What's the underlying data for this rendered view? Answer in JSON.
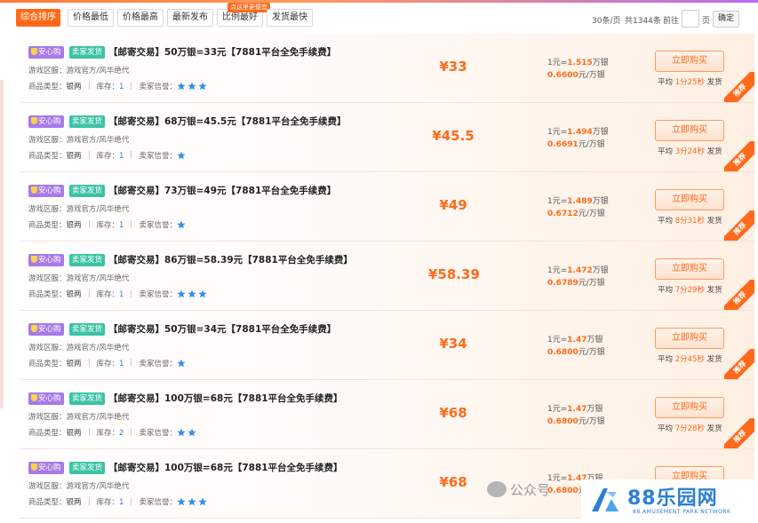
{
  "sort": {
    "tabs": [
      {
        "label": "综合排序",
        "active": true
      },
      {
        "label": "价格最低",
        "active": false
      },
      {
        "label": "价格最高",
        "active": false
      },
      {
        "label": "最新发布",
        "active": false
      },
      {
        "label": "比例最好",
        "active": false
      },
      {
        "label": "发货最快",
        "active": false
      }
    ],
    "promo_tag": "点这里更便宜"
  },
  "pager": {
    "per_page": "30条/页",
    "total": "共1344条",
    "goto_label": "前往",
    "page_input_value": "",
    "page_unit": "页",
    "confirm_label": "确定"
  },
  "labels": {
    "safe_badge": "安心购",
    "seller_badge": "卖家发货",
    "server_label": "游戏区服：",
    "type_label": "商品类型：",
    "stock_label": "库存：",
    "credit_label": "卖家信誉：",
    "buy_label": "立即购买",
    "avg_prefix": "平均",
    "avg_suffix": "发货",
    "ribbon": "推荐",
    "rate_prefix": "1元=",
    "rate_suffix": "万银",
    "unit_suffix": "元/万银"
  },
  "listings": [
    {
      "title": "【邮寄交易】50万银=33元【7881平台全免手续费】",
      "server": "游戏官方/风华绝代",
      "type": "银两",
      "stock": "1",
      "stars": 3,
      "price": "¥33",
      "rate": "1.515",
      "unit_price": "0.6600",
      "avg_time": "1分25秒"
    },
    {
      "title": "【邮寄交易】68万银=45.5元【7881平台全免手续费】",
      "server": "游戏官方/风华绝代",
      "type": "银两",
      "stock": "1",
      "stars": 1,
      "price": "¥45.5",
      "rate": "1.494",
      "unit_price": "0.6691",
      "avg_time": "3分24秒"
    },
    {
      "title": "【邮寄交易】73万银=49元【7881平台全免手续费】",
      "server": "游戏官方/风华绝代",
      "type": "银两",
      "stock": "1",
      "stars": 1,
      "price": "¥49",
      "rate": "1.489",
      "unit_price": "0.6712",
      "avg_time": "8分31秒"
    },
    {
      "title": "【邮寄交易】86万银=58.39元【7881平台全免手续费】",
      "server": "游戏官方/风华绝代",
      "type": "银两",
      "stock": "1",
      "stars": 3,
      "price": "¥58.39",
      "rate": "1.472",
      "unit_price": "0.6789",
      "avg_time": "7分29秒"
    },
    {
      "title": "【邮寄交易】50万银=34元【7881平台全免手续费】",
      "server": "游戏官方/风华绝代",
      "type": "银两",
      "stock": "1",
      "stars": 1,
      "price": "¥34",
      "rate": "1.47",
      "unit_price": "0.6800",
      "avg_time": "2分45秒"
    },
    {
      "title": "【邮寄交易】100万银=68元【7881平台全免手续费】",
      "server": "游戏官方/风华绝代",
      "type": "银两",
      "stock": "2",
      "stars": 2,
      "price": "¥68",
      "rate": "1.47",
      "unit_price": "0.6800",
      "avg_time": "7分28秒"
    },
    {
      "title": "【邮寄交易】100万银=68元【7881平台全免手续费】",
      "server": "游戏官方/风华绝代",
      "type": "银两",
      "stock": "1",
      "stars": 3,
      "price": "¥68",
      "rate": "1.47",
      "unit_price": "0.6800",
      "avg_time": ""
    }
  ],
  "watermarks": {
    "wechat_text": "公众号",
    "logo_text": "88乐园网",
    "logo_sub": "88 AMUSEMENT PARK NETWORK"
  },
  "colors": {
    "accent": "#ff6a1a",
    "safe_badge": "#a77ae8",
    "seller_badge": "#3cc3a6",
    "star": "#3a8ee6",
    "logo": "#2b7fd6"
  }
}
